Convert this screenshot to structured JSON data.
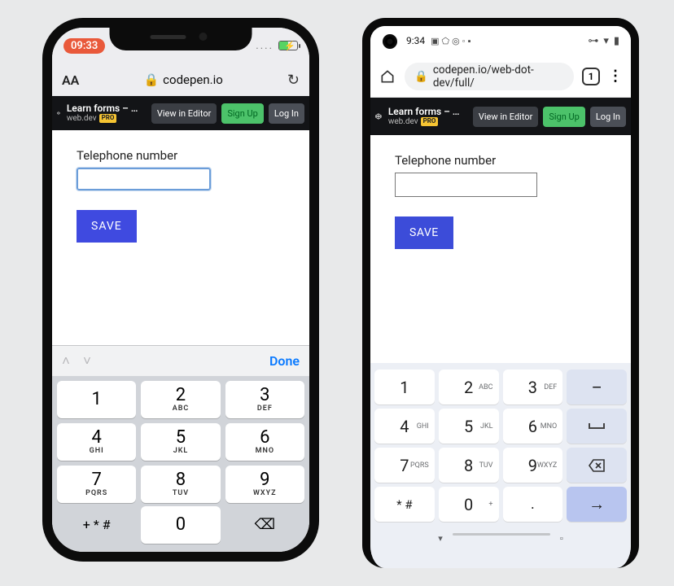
{
  "iphone": {
    "status": {
      "time": "09:33",
      "dots": "....",
      "battery_pct": 50
    },
    "url": "codepen.io",
    "aa": "AA",
    "codepen": {
      "title": "Learn forms – virt...",
      "author": "web.dev",
      "pro_label": "PRO",
      "view_btn": "View in Editor",
      "signup_btn": "Sign Up",
      "login_btn": "Log In"
    },
    "form": {
      "label": "Telephone number",
      "value": "",
      "save": "SAVE"
    },
    "kbd": {
      "done": "Done",
      "rows": [
        [
          {
            "n": "1",
            "l": ""
          },
          {
            "n": "2",
            "l": "ABC"
          },
          {
            "n": "3",
            "l": "DEF"
          }
        ],
        [
          {
            "n": "4",
            "l": "GHI"
          },
          {
            "n": "5",
            "l": "JKL"
          },
          {
            "n": "6",
            "l": "MNO"
          }
        ],
        [
          {
            "n": "7",
            "l": "PQRS"
          },
          {
            "n": "8",
            "l": "TUV"
          },
          {
            "n": "9",
            "l": "WXYZ"
          }
        ]
      ],
      "sym": "+ * #",
      "zero": "0",
      "del": "⌫"
    }
  },
  "android": {
    "status": {
      "time": "9:34",
      "left_glyphs": [
        "▣",
        "⬠",
        "◎",
        "◦",
        "▪"
      ],
      "right_glyphs": [
        "⊶",
        "▾",
        "▮"
      ]
    },
    "url_display": "codepen.io/web-dot-dev/full/",
    "tab_count": "1",
    "codepen": {
      "title": "Learn forms – virt...",
      "author": "web.dev",
      "pro_label": "PRO",
      "view_btn": "View in Editor",
      "signup_btn": "Sign Up",
      "login_btn": "Log In"
    },
    "form": {
      "label": "Telephone number",
      "value": "",
      "save": "SAVE"
    },
    "kbd": {
      "rows": [
        [
          {
            "n": "1",
            "l": ""
          },
          {
            "n": "2",
            "l": "ABC"
          },
          {
            "n": "3",
            "l": "DEF"
          },
          {
            "n": "–",
            "alt": true
          }
        ],
        [
          {
            "n": "4",
            "l": "GHI"
          },
          {
            "n": "5",
            "l": "JKL"
          },
          {
            "n": "6",
            "l": "MNO"
          },
          {
            "n": "␣",
            "alt": true,
            "space": true
          }
        ],
        [
          {
            "n": "7",
            "l": "PQRS"
          },
          {
            "n": "8",
            "l": "TUV"
          },
          {
            "n": "9",
            "l": "WXYZ"
          },
          {
            "n": "⌫",
            "alt": true,
            "del": true
          }
        ],
        [
          {
            "n": "* #",
            "sym": true
          },
          {
            "n": "0",
            "l": "+"
          },
          {
            "n": ".",
            "dot": true
          },
          {
            "n": "→",
            "enter": true
          }
        ]
      ]
    }
  }
}
